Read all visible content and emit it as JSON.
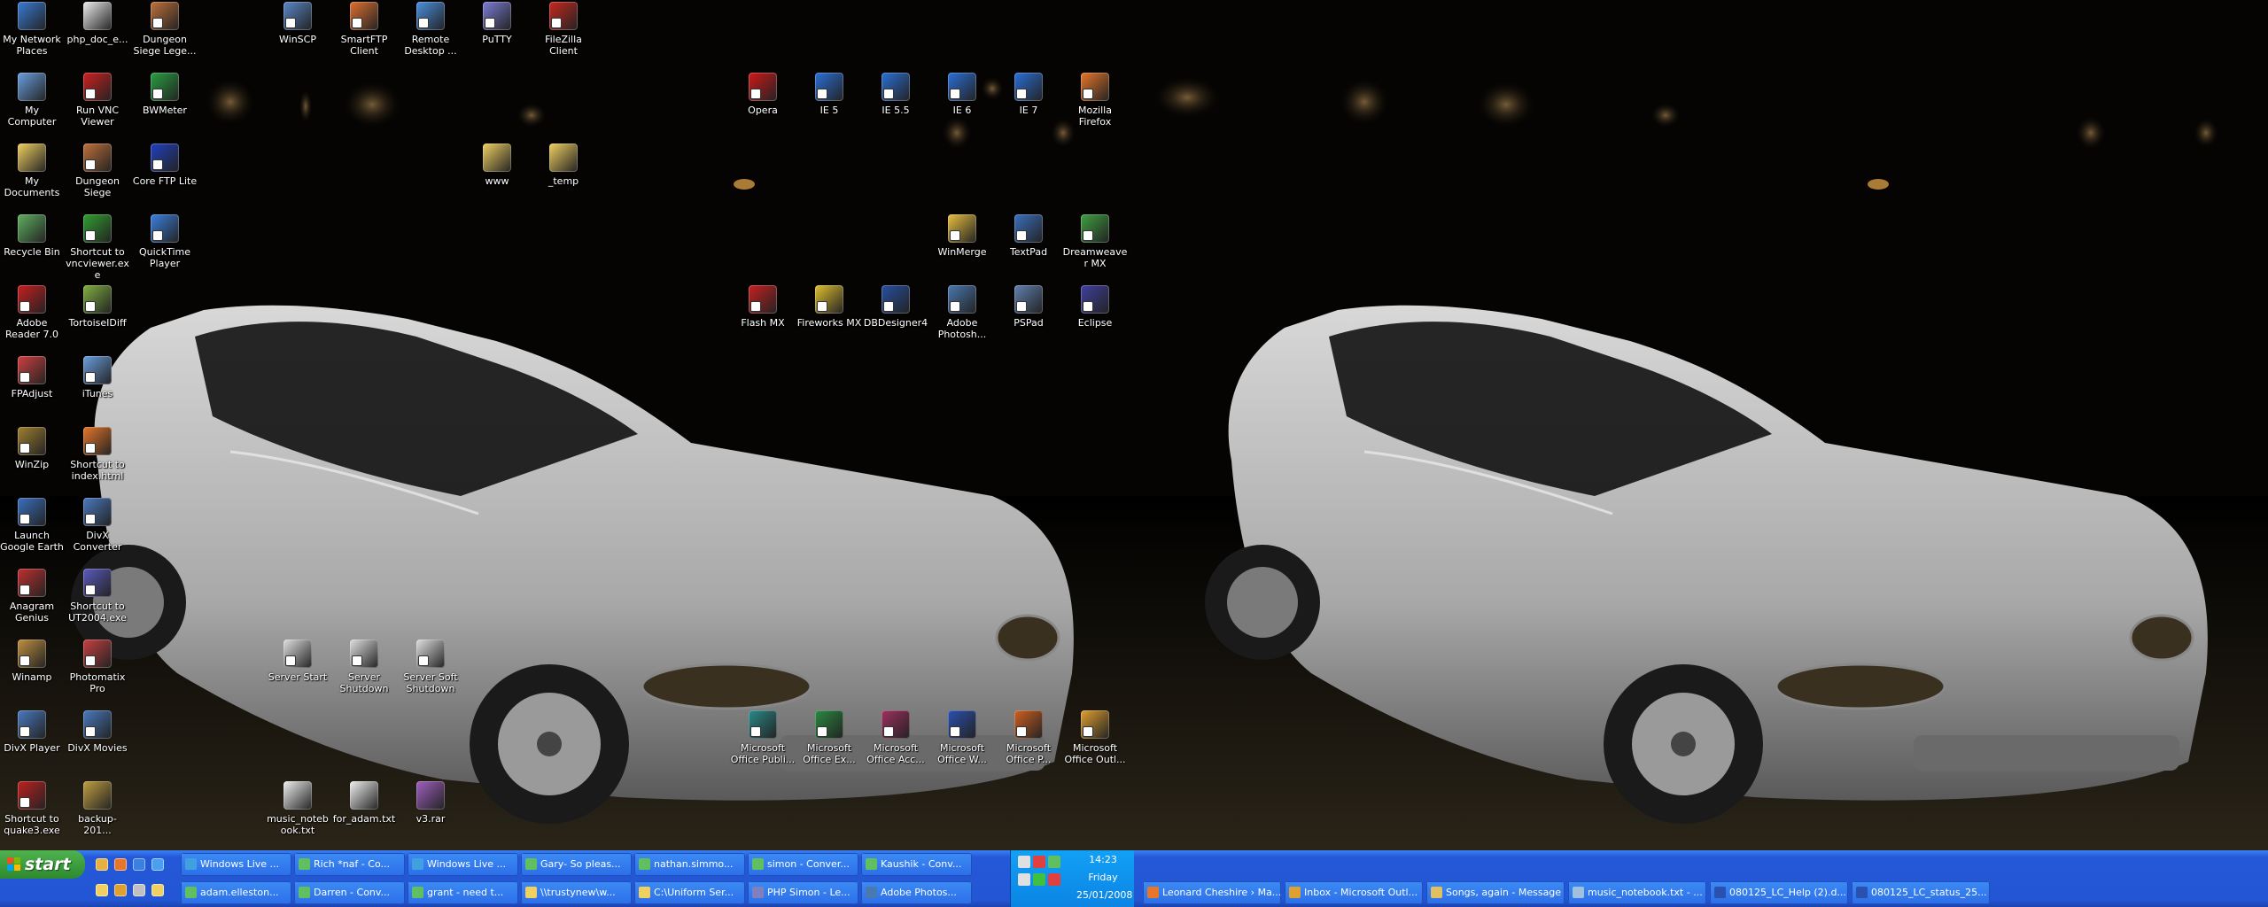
{
  "left_monitor": {
    "icons": [
      {
        "label": "My Network Places",
        "icon": "network-places-icon",
        "color": "#3a7bd5",
        "shortcut": false
      },
      {
        "label": "php_doc_e...",
        "icon": "document-icon",
        "color": "#eeeeee",
        "shortcut": false
      },
      {
        "label": "Dungeon Siege Lege...",
        "icon": "game-icon",
        "color": "#c0703a",
        "shortcut": true
      },
      {
        "label": "WinSCP",
        "icon": "winscp-icon",
        "color": "#5a88c8",
        "shortcut": true
      },
      {
        "label": "SmartFTP Client",
        "icon": "smartftp-icon",
        "color": "#e07030",
        "shortcut": true
      },
      {
        "label": "Remote Desktop ...",
        "icon": "remote-desktop-icon",
        "color": "#4a90e0",
        "shortcut": true
      },
      {
        "label": "PuTTY",
        "icon": "putty-icon",
        "color": "#7c7cd8",
        "shortcut": true
      },
      {
        "label": "FileZilla Client",
        "icon": "filezilla-icon",
        "color": "#c8281e",
        "shortcut": true
      },
      {
        "label": "My Computer",
        "icon": "my-computer-icon",
        "color": "#6aa0e0",
        "shortcut": false
      },
      {
        "label": "Run VNC Viewer",
        "icon": "vnc-icon",
        "color": "#d02020",
        "shortcut": true
      },
      {
        "label": "BWMeter",
        "icon": "bwmeter-icon",
        "color": "#28a040",
        "shortcut": true
      },
      {
        "label": "Opera",
        "icon": "opera-icon",
        "color": "#d01818",
        "shortcut": true
      },
      {
        "label": "IE 5",
        "icon": "ie-icon",
        "color": "#2a6fd8",
        "shortcut": true
      },
      {
        "label": "IE 5.5",
        "icon": "ie-icon",
        "color": "#2a6fd8",
        "shortcut": true
      },
      {
        "label": "IE 6",
        "icon": "ie-icon",
        "color": "#2a6fd8",
        "shortcut": true
      },
      {
        "label": "IE 7",
        "icon": "ie-icon",
        "color": "#2a6fd8",
        "shortcut": true
      },
      {
        "label": "Mozilla Firefox",
        "icon": "firefox-icon",
        "color": "#e8762a",
        "shortcut": true
      },
      {
        "label": "My Documents",
        "icon": "my-documents-icon",
        "color": "#f0d060",
        "shortcut": false
      },
      {
        "label": "Dungeon Siege",
        "icon": "game-icon",
        "color": "#c0703a",
        "shortcut": true
      },
      {
        "label": "Core FTP Lite",
        "icon": "coreftp-icon",
        "color": "#2040c0",
        "shortcut": true
      },
      {
        "label": "www",
        "icon": "folder-icon",
        "color": "#f0d060",
        "shortcut": false
      },
      {
        "label": "_temp",
        "icon": "folder-icon",
        "color": "#f0d060",
        "shortcut": false
      },
      {
        "label": "Recycle Bin",
        "icon": "recycle-bin-icon",
        "color": "#60b060",
        "shortcut": false
      },
      {
        "label": "Shortcut to vncviewer.exe",
        "icon": "vnc-icon",
        "color": "#30a030",
        "shortcut": true
      },
      {
        "label": "QuickTime Player",
        "icon": "quicktime-icon",
        "color": "#3a80e0",
        "shortcut": true
      },
      {
        "label": "WinMerge",
        "icon": "winmerge-icon",
        "color": "#e8c040",
        "shortcut": true
      },
      {
        "label": "TextPad",
        "icon": "textpad-icon",
        "color": "#3a70c0",
        "shortcut": true
      },
      {
        "label": "Dreamweaver MX",
        "icon": "dreamweaver-icon",
        "color": "#40a040",
        "shortcut": true
      },
      {
        "label": "Adobe Reader 7.0",
        "icon": "adobe-reader-icon",
        "color": "#c81e1e",
        "shortcut": true
      },
      {
        "label": "TortoiseIDiff",
        "icon": "tortoise-icon",
        "color": "#80b040",
        "shortcut": true
      },
      {
        "label": "Flash MX",
        "icon": "flash-icon",
        "color": "#c82020",
        "shortcut": true
      },
      {
        "label": "Fireworks MX",
        "icon": "fireworks-icon",
        "color": "#e0c030",
        "shortcut": true
      },
      {
        "label": "DBDesigner4",
        "icon": "dbdesigner-icon",
        "color": "#2850a0",
        "shortcut": true
      },
      {
        "label": "Adobe Photosh...",
        "icon": "photoshop-icon",
        "color": "#4a78b0",
        "shortcut": true
      },
      {
        "label": "PSPad",
        "icon": "pspad-icon",
        "color": "#6080b0",
        "shortcut": true
      },
      {
        "label": "Eclipse",
        "icon": "eclipse-icon",
        "color": "#4040a0",
        "shortcut": true
      },
      {
        "label": "FPAdjust",
        "icon": "fpadjust-icon",
        "color": "#d04040",
        "shortcut": true
      },
      {
        "label": "iTunes",
        "icon": "itunes-icon",
        "color": "#6aa0e0",
        "shortcut": true
      },
      {
        "label": "WinZip",
        "icon": "winzip-icon",
        "color": "#a08030",
        "shortcut": true
      },
      {
        "label": "Shortcut to index.html",
        "icon": "firefox-icon",
        "color": "#e8762a",
        "shortcut": true
      },
      {
        "label": "Launch Google Earth",
        "icon": "google-earth-icon",
        "color": "#3a70c0",
        "shortcut": true
      },
      {
        "label": "DivX Converter",
        "icon": "divx-icon",
        "color": "#4a7ac0",
        "shortcut": true
      },
      {
        "label": "Anagram Genius",
        "icon": "anagram-icon",
        "color": "#c03030",
        "shortcut": true
      },
      {
        "label": "Shortcut to UT2004.exe",
        "icon": "ut2004-icon",
        "color": "#5a5ac0",
        "shortcut": true
      },
      {
        "label": "Server Start",
        "icon": "batch-icon",
        "color": "#e0e0e0",
        "shortcut": true
      },
      {
        "label": "Server Shutdown",
        "icon": "batch-icon",
        "color": "#e0e0e0",
        "shortcut": true
      },
      {
        "label": "Server Soft Shutdown",
        "icon": "batch-icon",
        "color": "#e0e0e0",
        "shortcut": true
      },
      {
        "label": "Winamp",
        "icon": "winamp-icon",
        "color": "#c09040",
        "shortcut": true
      },
      {
        "label": "Photomatix Pro",
        "icon": "photomatix-icon",
        "color": "#c84040",
        "shortcut": true
      },
      {
        "label": "Microsoft Office Publi...",
        "icon": "publisher-icon",
        "color": "#2a8a8a",
        "shortcut": true
      },
      {
        "label": "Microsoft Office Ex...",
        "icon": "excel-icon",
        "color": "#2a8a40",
        "shortcut": true
      },
      {
        "label": "Microsoft Office Acc...",
        "icon": "access-icon",
        "color": "#a03060",
        "shortcut": true
      },
      {
        "label": "Microsoft Office W...",
        "icon": "word-icon",
        "color": "#2a50b0",
        "shortcut": true
      },
      {
        "label": "Microsoft Office P...",
        "icon": "powerpoint-icon",
        "color": "#d06020",
        "shortcut": true
      },
      {
        "label": "Microsoft Office Outl...",
        "icon": "outlook-icon",
        "color": "#e0a030",
        "shortcut": true
      },
      {
        "label": "DivX Player",
        "icon": "divx-icon",
        "color": "#4a7ac0",
        "shortcut": true
      },
      {
        "label": "DivX Movies",
        "icon": "divx-icon",
        "color": "#4a7ac0",
        "shortcut": true
      },
      {
        "label": "Shortcut to quake3.exe",
        "icon": "quake-icon",
        "color": "#c02020",
        "shortcut": true
      },
      {
        "label": "backup-201...",
        "icon": "archive-icon",
        "color": "#c0a040",
        "shortcut": false
      },
      {
        "label": "music_notebook.txt",
        "icon": "text-file-icon",
        "color": "#f0f0f0",
        "shortcut": false
      },
      {
        "label": "for_adam.txt",
        "icon": "text-file-icon",
        "color": "#f0f0f0",
        "shortcut": false
      },
      {
        "label": "v3.rar",
        "icon": "rar-icon",
        "color": "#a060c0",
        "shortcut": false
      }
    ],
    "taskbar": {
      "start_label": "start",
      "quick_launch": [
        {
          "icon": "desktop-icon",
          "color": "#e8b040"
        },
        {
          "icon": "firefox-icon",
          "color": "#e8762a"
        },
        {
          "icon": "media-icon",
          "color": "#3a80e0"
        },
        {
          "icon": "ie-icon",
          "color": "#4aa0f0"
        },
        {
          "icon": "explorer-icon",
          "color": "#f0d060"
        },
        {
          "icon": "outlook-icon",
          "color": "#e0a030"
        },
        {
          "icon": "tool-icon",
          "color": "#c0c0c0"
        },
        {
          "icon": "folder-icon",
          "color": "#f0d060"
        }
      ],
      "buttons": [
        {
          "label": "Windows Live ...",
          "icon": "messenger-icon",
          "color": "#40a0e0"
        },
        {
          "label": "Rich *naf - Co...",
          "icon": "chat-icon",
          "color": "#60c060"
        },
        {
          "label": "Windows Live ...",
          "icon": "messenger-icon",
          "color": "#40a0e0"
        },
        {
          "label": "Gary- So pleas...",
          "icon": "chat-icon",
          "color": "#60c060"
        },
        {
          "label": "nathan.simmo...",
          "icon": "chat-icon",
          "color": "#60c060"
        },
        {
          "label": "simon - Conver...",
          "icon": "chat-icon",
          "color": "#60c060"
        },
        {
          "label": "Kaushik - Conv...",
          "icon": "chat-icon",
          "color": "#60c060"
        },
        {
          "label": "adam.elleston...",
          "icon": "chat-icon",
          "color": "#60c060"
        },
        {
          "label": "Darren - Conv...",
          "icon": "chat-icon",
          "color": "#60c060"
        },
        {
          "label": "grant - need t...",
          "icon": "chat-icon",
          "color": "#60c060"
        },
        {
          "label": "\\\\trustynew\\w...",
          "icon": "folder-icon",
          "color": "#f0d060"
        },
        {
          "label": "C:\\Uniform Ser...",
          "icon": "folder-icon",
          "color": "#f0d060"
        },
        {
          "label": "PHP Simon - Le...",
          "icon": "php-icon",
          "color": "#8080c0"
        },
        {
          "label": "Adobe Photos...",
          "icon": "photoshop-icon",
          "color": "#4a78b0"
        }
      ],
      "tray_icons": [
        {
          "icon": "vnc-tray-icon",
          "color": "#e0e0e0"
        },
        {
          "icon": "opera-tray-icon",
          "color": "#e04040"
        },
        {
          "icon": "network-tray-icon",
          "color": "#60c060"
        },
        {
          "icon": "volume-tray-icon",
          "color": "#e0e0e0"
        },
        {
          "icon": "messenger-tray-icon",
          "color": "#40c040"
        },
        {
          "icon": "antivirus-tray-icon",
          "color": "#e04040"
        }
      ],
      "clock_time": "14:23",
      "clock_day": "Friday",
      "clock_date": "25/01/2008"
    }
  },
  "right_monitor": {
    "taskbar": {
      "buttons": [
        {
          "label": "Leonard Cheshire › Ma...",
          "icon": "firefox-icon",
          "color": "#e8762a"
        },
        {
          "label": "Inbox - Microsoft Outl...",
          "icon": "outlook-icon",
          "color": "#e0a030"
        },
        {
          "label": "Songs, again - Message",
          "icon": "mail-icon",
          "color": "#e0c060"
        },
        {
          "label": "music_notebook.txt - ...",
          "icon": "notepad-icon",
          "color": "#a0c0e0"
        },
        {
          "label": "080125_LC_Help (2).d...",
          "icon": "word-icon",
          "color": "#2a50b0"
        },
        {
          "label": "080125_LC_status_25...",
          "icon": "word-icon",
          "color": "#2a50b0"
        }
      ]
    }
  }
}
